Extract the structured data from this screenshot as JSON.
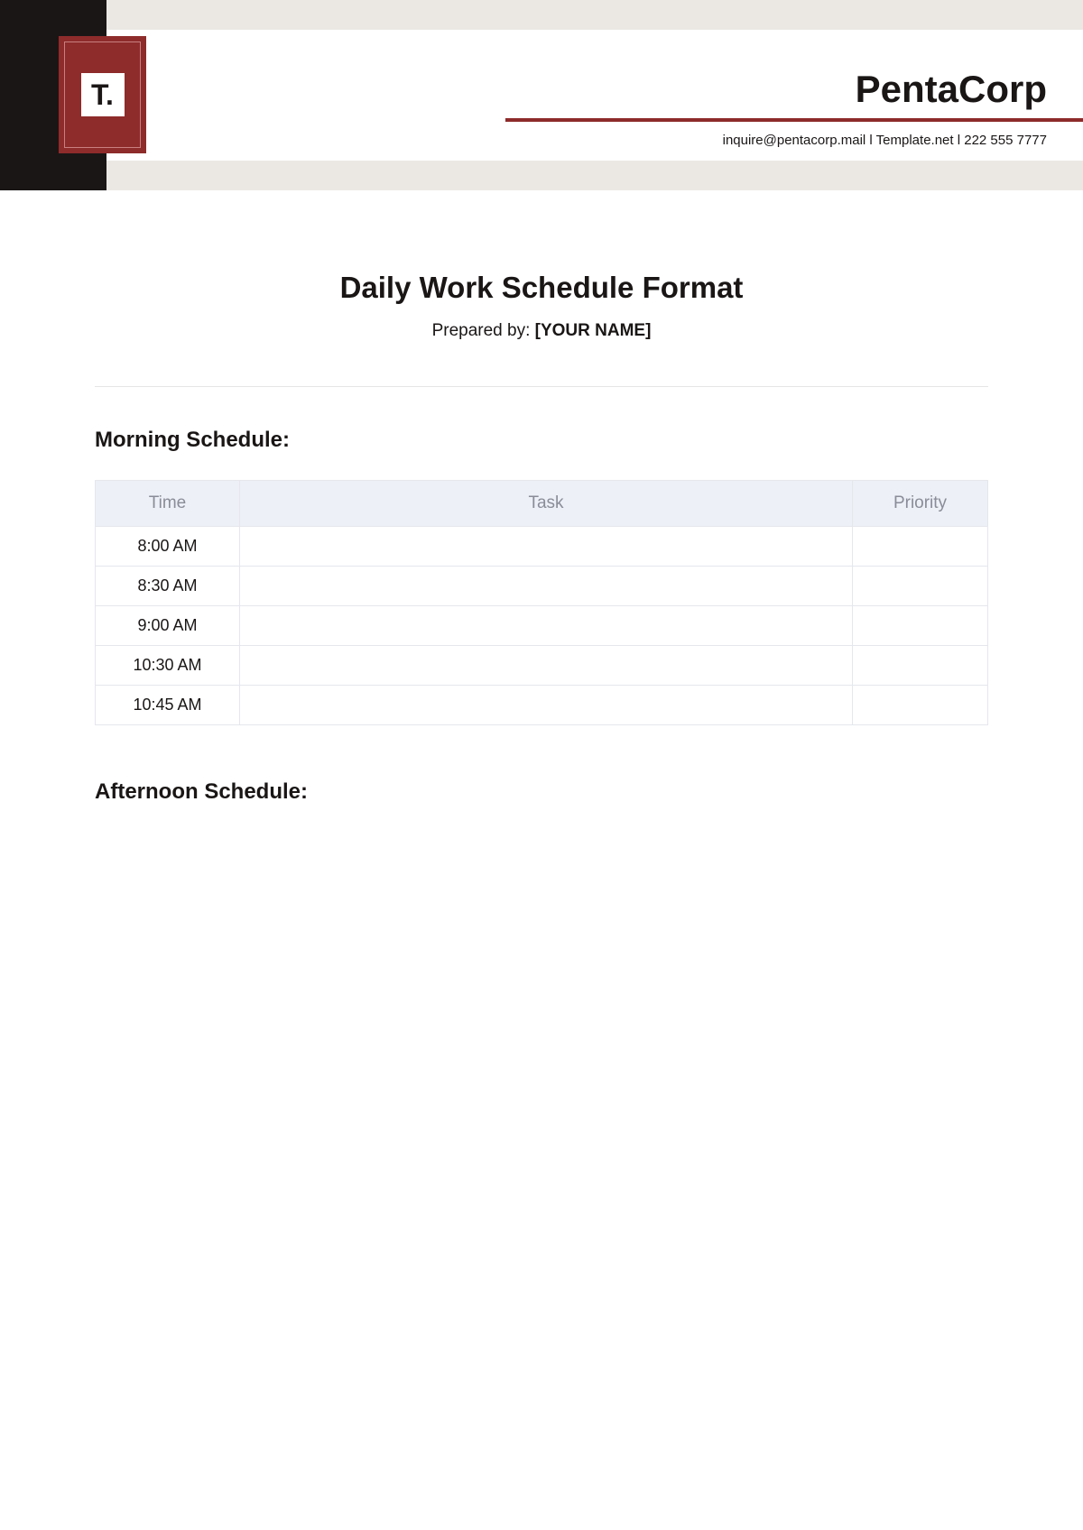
{
  "logo": {
    "text": "T."
  },
  "header": {
    "company_name": "PentaCorp",
    "email": "inquire@pentacorp.mail",
    "website": "Template.net",
    "phone": "222 555 7777",
    "separator": "  l  "
  },
  "document": {
    "title": "Daily Work Schedule Format",
    "prepared_by_label": "Prepared by: ",
    "prepared_by_name": "[YOUR NAME]"
  },
  "sections": {
    "morning": {
      "title": "Morning Schedule:",
      "columns": {
        "time": "Time",
        "task": "Task",
        "priority": "Priority"
      },
      "rows": [
        {
          "time": "8:00 AM",
          "task": "",
          "priority": ""
        },
        {
          "time": "8:30 AM",
          "task": "",
          "priority": ""
        },
        {
          "time": "9:00 AM",
          "task": "",
          "priority": ""
        },
        {
          "time": "10:30 AM",
          "task": "",
          "priority": ""
        },
        {
          "time": "10:45 AM",
          "task": "",
          "priority": ""
        }
      ]
    },
    "afternoon": {
      "title": "Afternoon Schedule:"
    }
  }
}
